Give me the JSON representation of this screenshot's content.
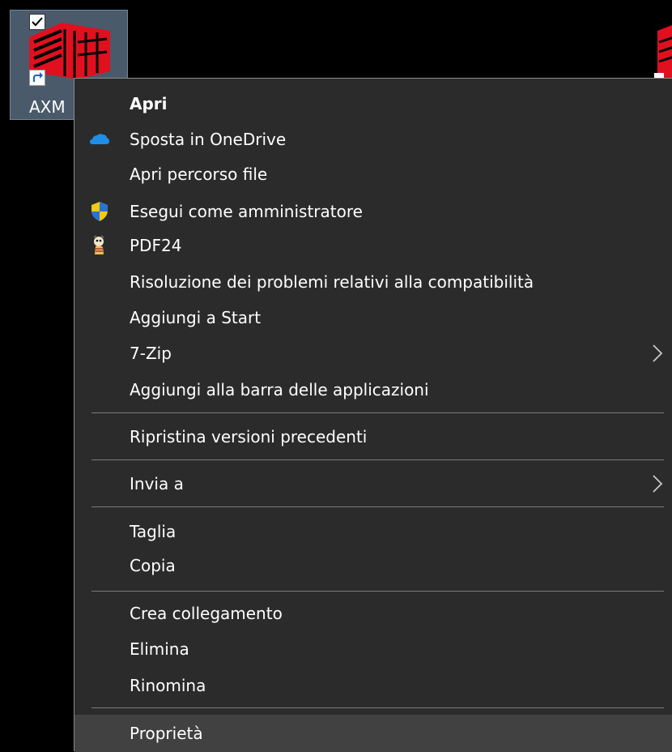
{
  "desktop": {
    "icon_label": "AXM",
    "icon_checked": true
  },
  "menu": {
    "items": [
      {
        "label": "Apri",
        "icon": "",
        "bold": true
      },
      {
        "label": "Sposta in OneDrive",
        "icon": "onedrive-cloud-icon"
      },
      {
        "label": "Apri percorso file",
        "icon": ""
      },
      {
        "label": "Esegui come amministratore",
        "icon": "uac-shield-icon"
      },
      {
        "label": "PDF24",
        "icon": "pdf24-icon"
      },
      {
        "label": "Risoluzione dei problemi relativi alla compatibilità",
        "icon": ""
      },
      {
        "label": "Aggiungi a Start",
        "icon": ""
      },
      {
        "label": "7-Zip",
        "icon": "",
        "submenu": true
      },
      {
        "label": "Aggiungi alla barra delle applicazioni",
        "icon": ""
      },
      {
        "label": "Ripristina versioni precedenti",
        "icon": ""
      },
      {
        "label": "Invia a",
        "icon": "",
        "submenu": true
      },
      {
        "label": "Taglia",
        "icon": ""
      },
      {
        "label": "Copia",
        "icon": ""
      },
      {
        "label": "Crea collegamento",
        "icon": ""
      },
      {
        "label": "Elimina",
        "icon": ""
      },
      {
        "label": "Rinomina",
        "icon": ""
      },
      {
        "label": "Proprietà",
        "icon": "",
        "hovered": true
      }
    ]
  },
  "colors": {
    "menu_bg": "#2b2b2b",
    "hover_bg": "#414141",
    "separator": "#7b7b7b",
    "text": "#ffffff",
    "brand_red": "#e0101e"
  }
}
